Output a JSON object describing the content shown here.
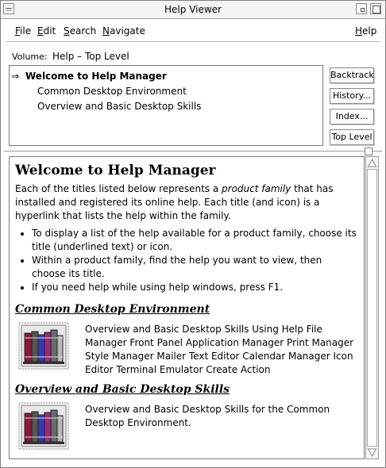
{
  "window": {
    "title": "Help Viewer"
  },
  "menubar": {
    "file": {
      "mnemonic": "F",
      "rest": "ile"
    },
    "edit": {
      "mnemonic": "E",
      "rest": "dit"
    },
    "search": {
      "mnemonic": "S",
      "rest": "earch"
    },
    "navigate": {
      "mnemonic": "N",
      "rest": "avigate"
    },
    "help": {
      "mnemonic": "H",
      "rest": "elp"
    }
  },
  "volume": {
    "label": "Volume:",
    "value": "Help – Top Level"
  },
  "topics": {
    "current_marker": "⇒",
    "current": "Welcome to Help Manager",
    "items": [
      "Common Desktop Environment",
      "Overview and Basic Desktop Skills"
    ]
  },
  "buttons": {
    "backtrack": "Backtrack",
    "history": "History...",
    "index": "Index...",
    "top_level": "Top Level"
  },
  "content": {
    "title": "Welcome to Help Manager",
    "intro_before": "Each of the titles listed below represents a ",
    "intro_em": "product family",
    "intro_after": " that has installed and registered its online help. Each title (and icon) is a hyperlink that lists the help within the family.",
    "bullets": [
      "To display a list of the help available for a product family, choose its title (underlined text) or icon.",
      "Within a product family, find the help you want to view, then choose its title.",
      "If you need help while using help windows, press F1."
    ],
    "sections": [
      {
        "title": "Common Desktop Environment",
        "description": "Overview and Basic Desktop Skills Using Help File Manager Front Panel Application Manager Print Manager Style Manager Mailer Text Editor Calendar Manager Icon Editor Terminal Emulator Create Action"
      },
      {
        "title": "Overview and Basic Desktop Skills",
        "description": "Overview and Basic Desktop Skills for the Common Desktop Environment."
      }
    ]
  },
  "icons": {
    "window_menu": "window-menu-icon",
    "minimize": "minimize-icon",
    "maximize": "maximize-icon",
    "books": "books-icon"
  }
}
